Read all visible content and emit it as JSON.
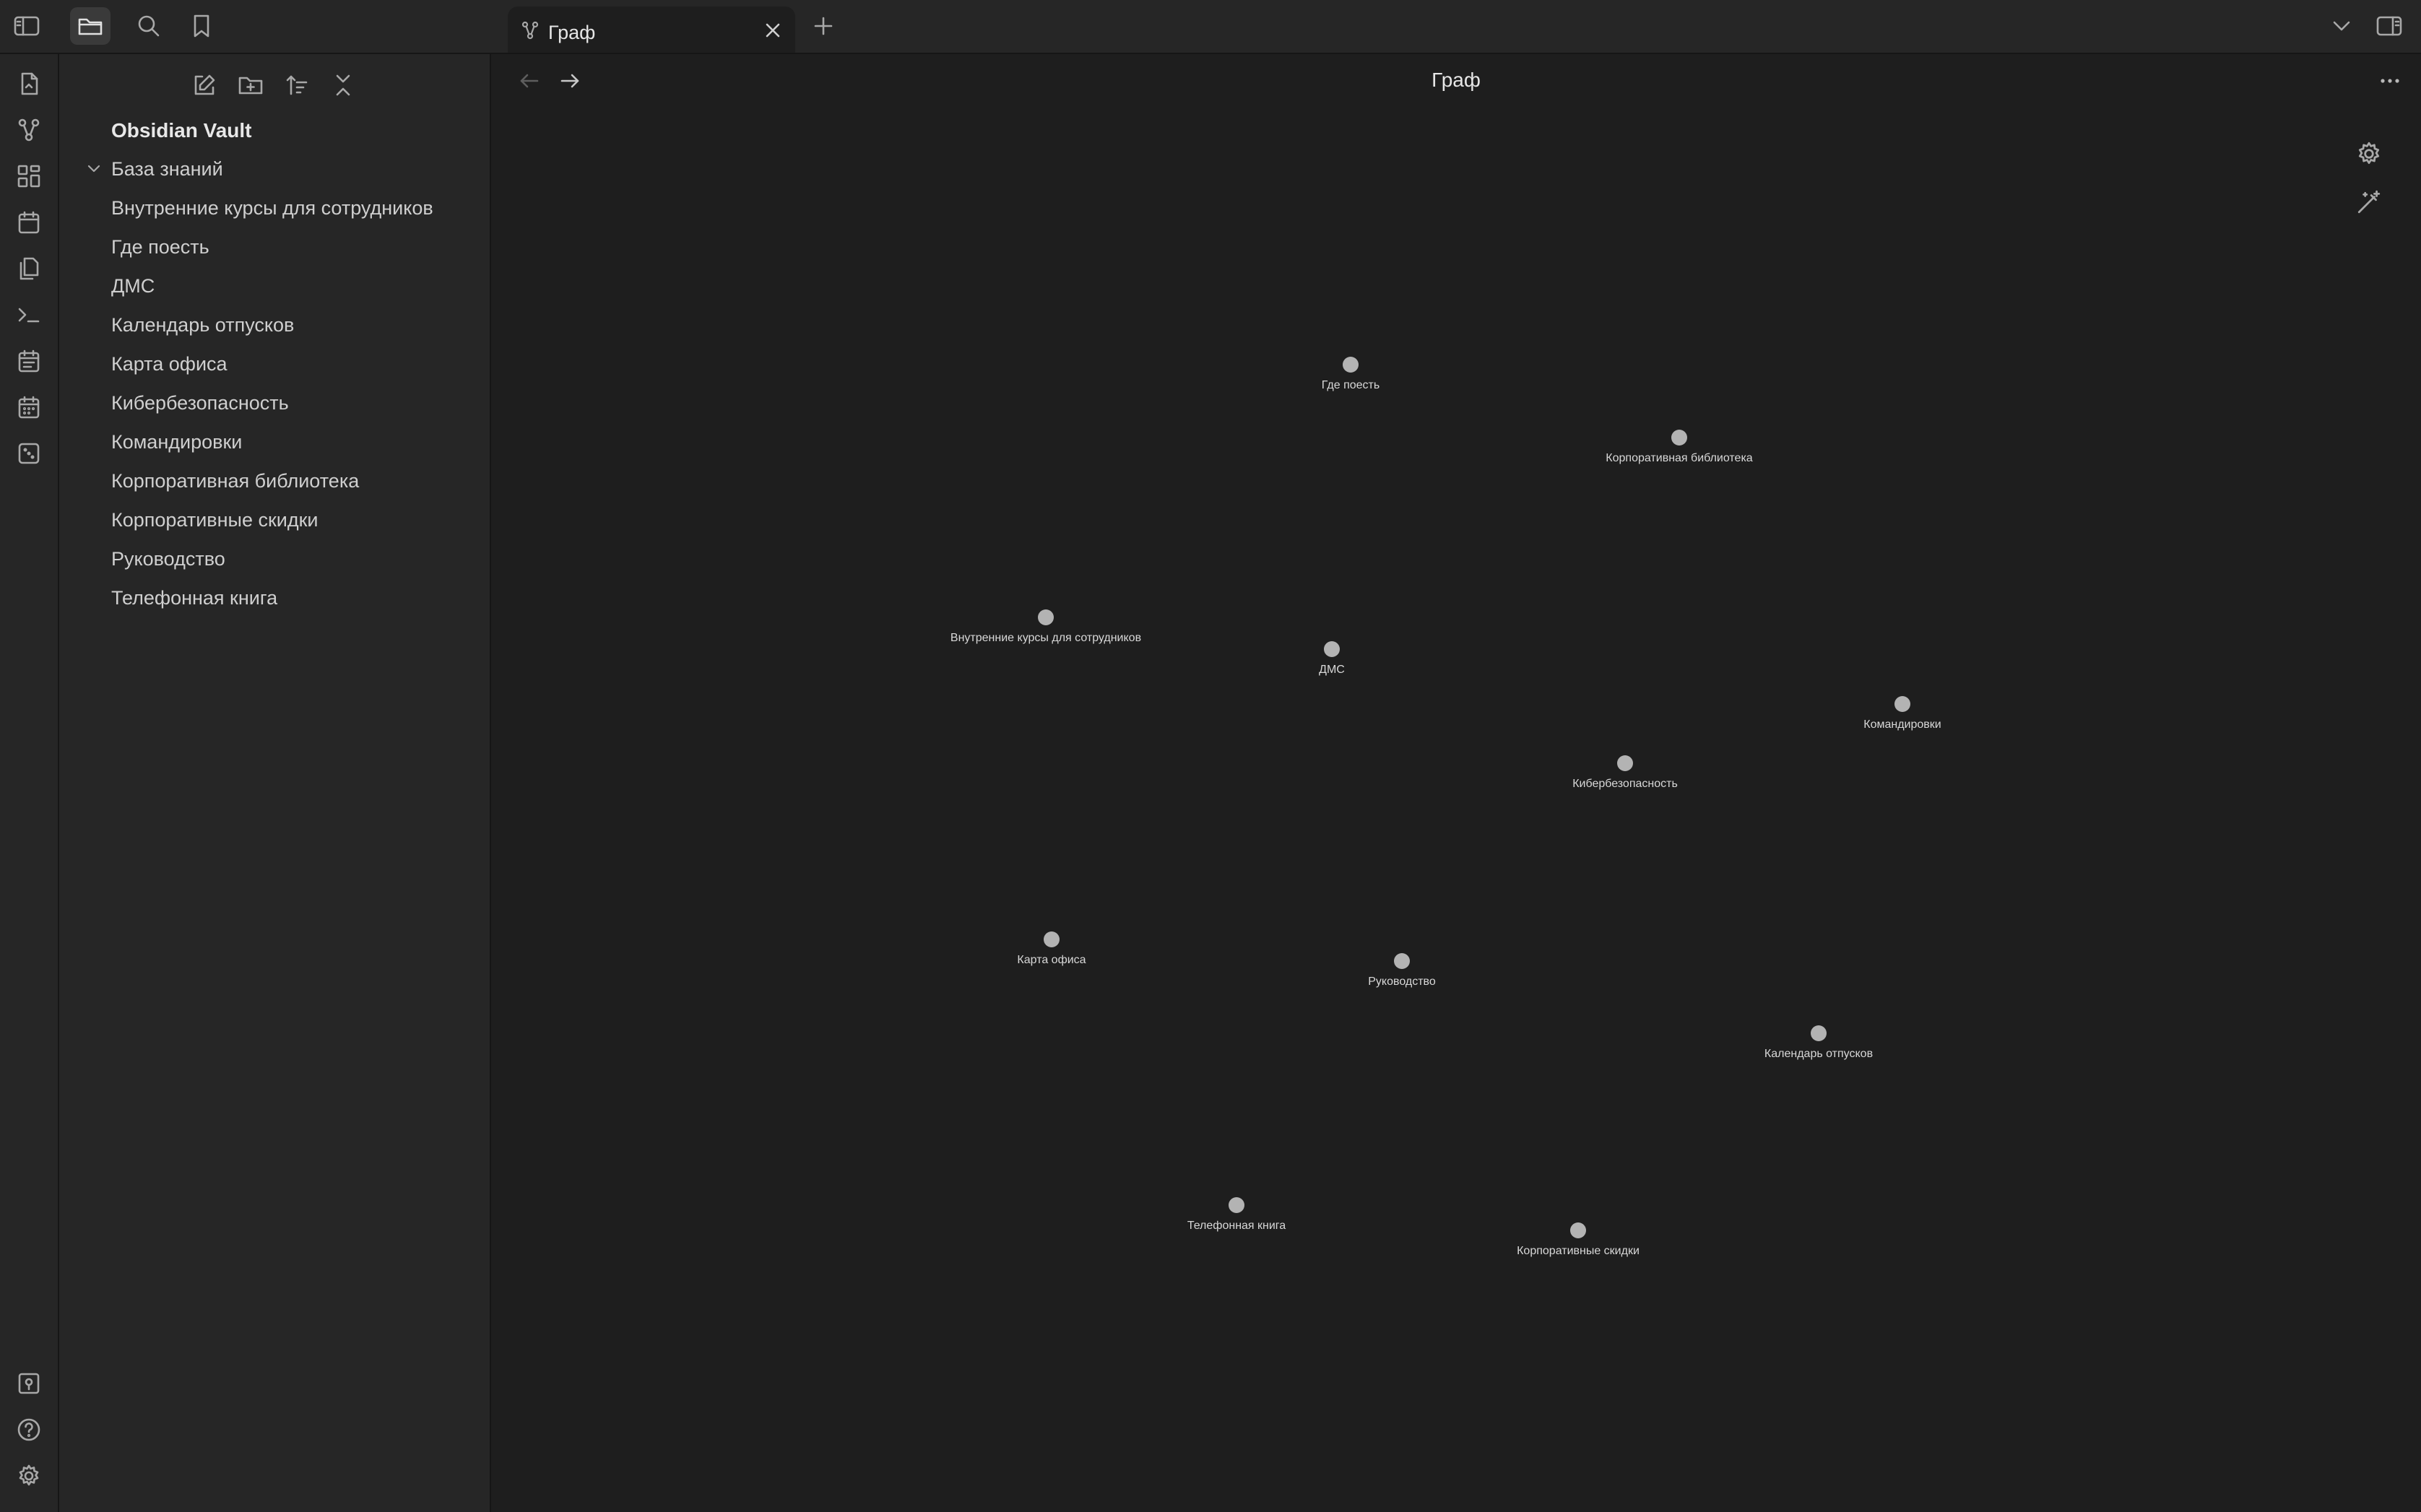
{
  "tab": {
    "title": "Граф"
  },
  "view": {
    "title": "Граф"
  },
  "sidebar": {
    "vault_name": "Obsidian Vault",
    "folder": "База знаний",
    "files": [
      "Внутренние курсы для сотрудников",
      "Где поесть",
      "ДМС",
      "Календарь отпусков",
      "Карта офиса",
      "Кибербезопасность",
      "Командировки",
      "Корпоративная библиотека",
      "Корпоративные скидки",
      "Руководство",
      "Телефонная книга"
    ]
  },
  "graph": {
    "nodes": [
      "Где поесть",
      "Корпоративная библиотека",
      "Внутренние курсы для сотрудников",
      "ДМС",
      "Командировки",
      "Кибербезопасность",
      "Карта офиса",
      "Руководство",
      "Календарь отпусков",
      "Телефонная книга",
      "Корпоративные скидки"
    ],
    "node_color": "#b3b3b3"
  },
  "icons": {
    "topbar": [
      "sidebar-toggle-icon",
      "folder-icon",
      "search-icon",
      "bookmark-icon",
      "graph-icon",
      "close-icon",
      "plus-icon",
      "chevron-down-icon",
      "right-sidebar-icon"
    ],
    "ribbon": [
      "quick-switcher-icon",
      "graph-view-icon",
      "canvas-icon",
      "daily-note-icon",
      "templates-icon",
      "command-palette-icon",
      "calendar-icon",
      "calendar-grid-icon",
      "random-note-icon",
      "vault-switcher-icon",
      "help-icon",
      "settings-icon"
    ]
  }
}
